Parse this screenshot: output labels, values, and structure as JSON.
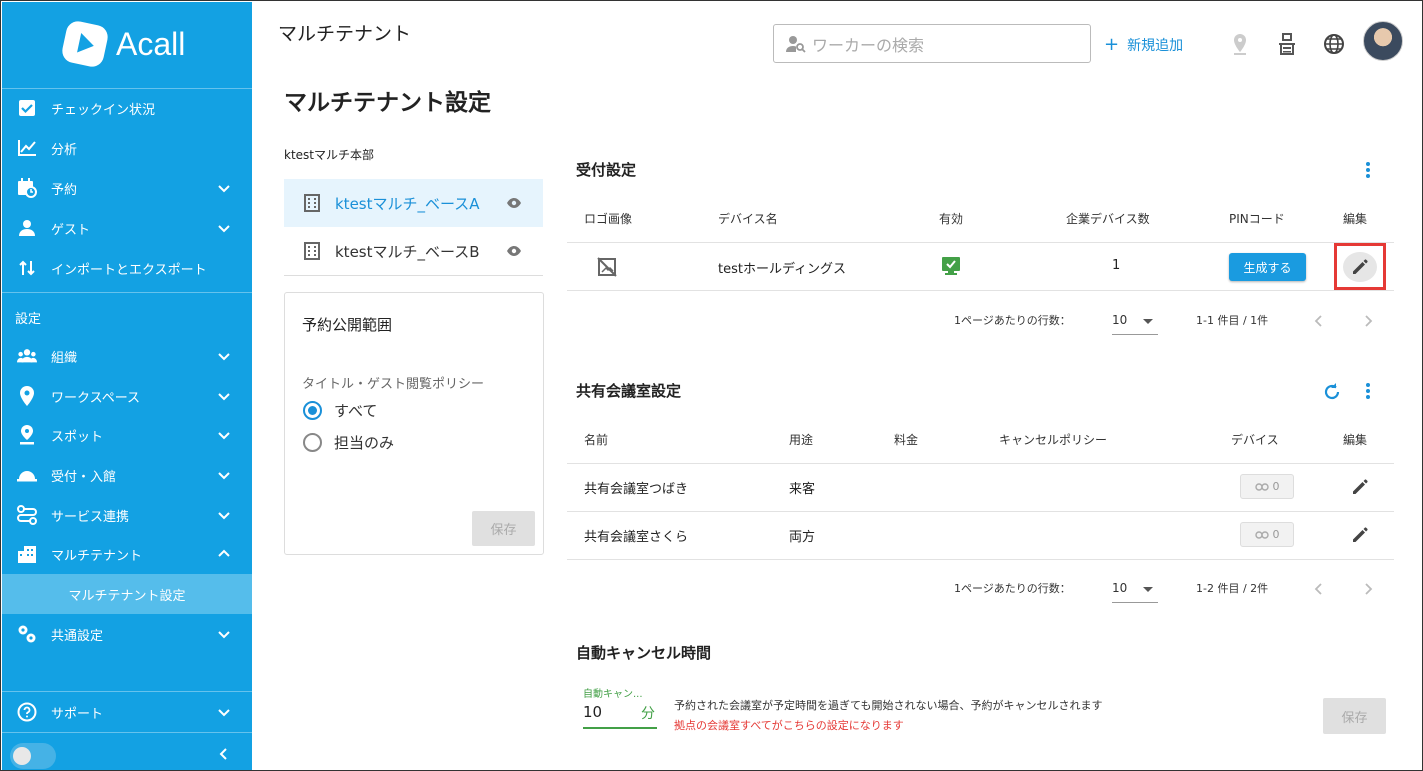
{
  "app": {
    "logo_text": "Acall"
  },
  "sidebar": {
    "items": [
      {
        "label": "チェックイン状況",
        "icon": "checkbox-icon"
      },
      {
        "label": "分析",
        "icon": "chart-line-icon"
      },
      {
        "label": "予約",
        "icon": "calendar-clock-icon"
      },
      {
        "label": "ゲスト",
        "icon": "guest-icon"
      },
      {
        "label": "インポートとエクスポート",
        "icon": "import-export-icon"
      }
    ],
    "section_label": "設定",
    "settings_items": [
      {
        "label": "組織",
        "icon": "group-icon"
      },
      {
        "label": "ワークスペース",
        "icon": "location-pin-icon"
      },
      {
        "label": "スポット",
        "icon": "spot-icon"
      },
      {
        "label": "受付・入館",
        "icon": "reception-icon"
      },
      {
        "label": "サービス連携",
        "icon": "integration-icon"
      },
      {
        "label": "マルチテナント",
        "icon": "building-icon"
      }
    ],
    "sub_item": "マルチテナント設定",
    "common_settings": "共通設定",
    "support": "サポート"
  },
  "header": {
    "page_label": "マルチテナント",
    "search_placeholder": "ワーカーの検索",
    "add_label": "新規追加"
  },
  "title": "マルチテナント設定",
  "tenants": {
    "org_name": "ktestマルチ本部",
    "items": [
      "ktestマルチ_ベースA",
      "ktestマルチ_ベースB"
    ]
  },
  "booking_scope": {
    "title": "予約公開範囲",
    "policy_label": "タイトル・ゲスト閲覧ポリシー",
    "options": [
      "すべて",
      "担当のみ"
    ],
    "selected": "すべて",
    "save_label": "保存"
  },
  "reception": {
    "title": "受付設定",
    "columns": [
      "ロゴ画像",
      "デバイス名",
      "有効",
      "企業デバイス数",
      "PINコード",
      "編集"
    ],
    "row": {
      "device_name": "testホールディングス",
      "enabled": true,
      "device_count": "1",
      "pin_button": "生成する"
    },
    "pager": {
      "rows_label": "1ページあたりの行数：",
      "rows_value": "10",
      "range": "1-1 件目 / 1件"
    }
  },
  "meeting_rooms": {
    "title": "共有会議室設定",
    "columns": [
      "名前",
      "用途",
      "料金",
      "キャンセルポリシー",
      "デバイス",
      "編集"
    ],
    "rows": [
      {
        "name": "共有会議室つばき",
        "purpose": "来客",
        "devices": "0"
      },
      {
        "name": "共有会議室さくら",
        "purpose": "両方",
        "devices": "0"
      }
    ],
    "pager": {
      "rows_label": "1ページあたりの行数：",
      "rows_value": "10",
      "range": "1-2 件目 / 2件"
    }
  },
  "auto_cancel": {
    "title": "自動キャンセル時間",
    "field_label": "自動キャン...",
    "value": "10",
    "unit": "分",
    "note": "予約された会議室が予定時間を過ぎても開始されない場合、予約がキャンセルされます",
    "warning": "拠点の会議室すべてがこちらの設定になります",
    "save_label": "保存"
  },
  "colors": {
    "sidebar": "#13a1e3",
    "accent": "#1a90d8",
    "highlight": "#e53935",
    "success": "#43a047"
  }
}
